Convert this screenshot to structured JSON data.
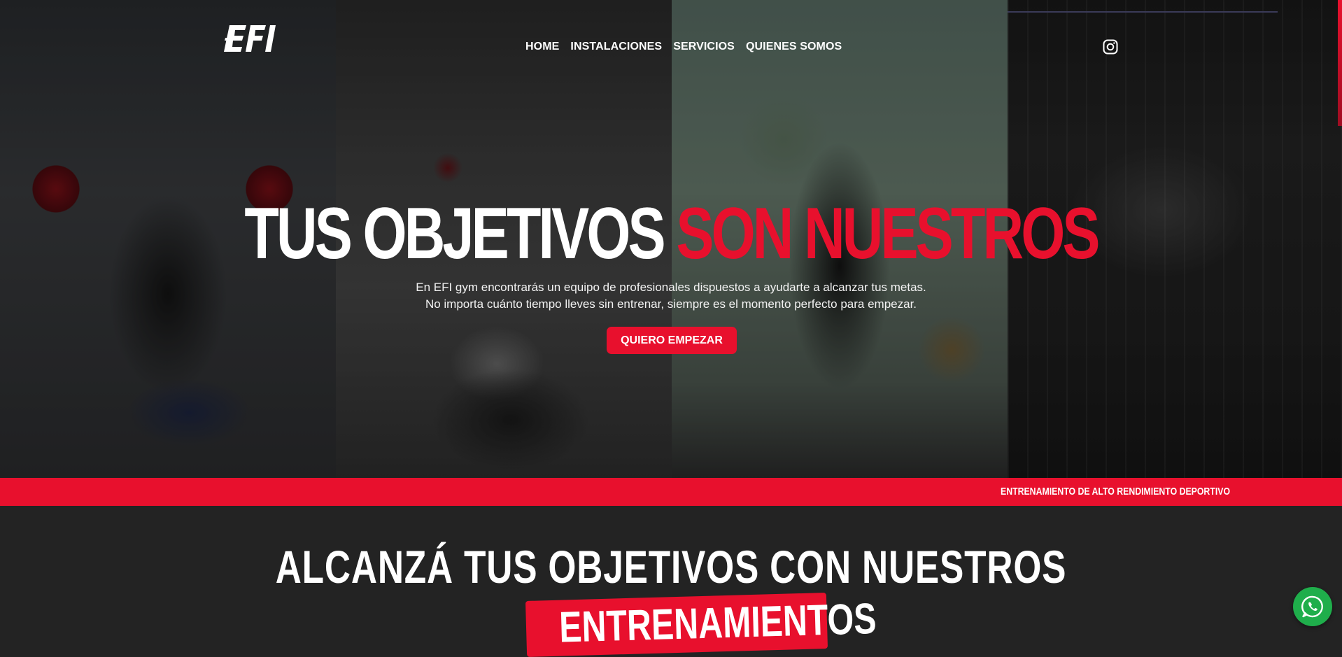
{
  "header": {
    "logo_text": "EFI",
    "nav": [
      {
        "label": "HOME"
      },
      {
        "label": "INSTALACIONES"
      },
      {
        "label": "SERVICIOS"
      },
      {
        "label": "QUIENES SOMOS"
      }
    ],
    "social_icon": "instagram-icon"
  },
  "hero": {
    "title_white": "TUS OBJETIVOS",
    "title_red": "SON NUESTROS",
    "subtitle_line1": "En EFI gym encontrarás un equipo de profesionales dispuestos a ayudarte a alcanzar tus metas.",
    "subtitle_line2": "No importa cuánto tiempo lleves sin entrenar, siempre es el momento perfecto para empezar.",
    "cta_label": "QUIERO EMPEZAR"
  },
  "band": {
    "text": "ENTRENAMIENTO DE ALTO RENDIMIENTO DEPORTIVO"
  },
  "section": {
    "title": "ALCANZÁ TUS OBJETIVOS CON NUESTROS",
    "highlight": "ENTRENAMIENTOS"
  },
  "floating": {
    "whatsapp_icon": "whatsapp-icon"
  },
  "colors": {
    "accent": "#e8102d",
    "background": "#232323",
    "whatsapp": "#1fae4b"
  }
}
